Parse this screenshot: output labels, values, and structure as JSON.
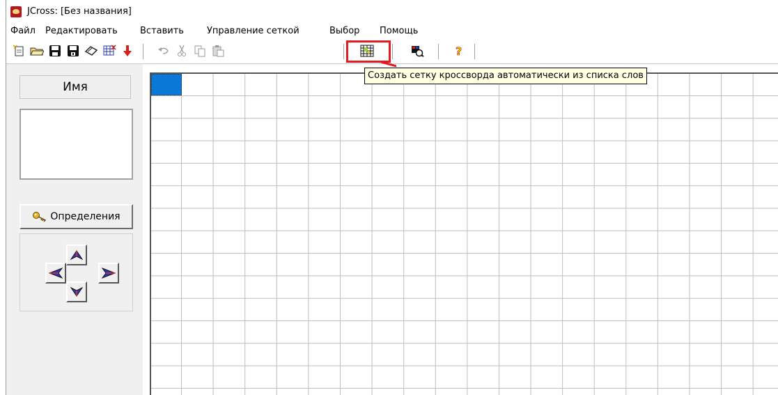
{
  "window": {
    "title": "JCross: [Без названия]"
  },
  "menu": {
    "items": [
      "Файл",
      "Редактировать",
      "Вставить",
      "Управление сеткой",
      "Выбор",
      "Помощь"
    ]
  },
  "toolbar": {
    "buttons": [
      {
        "icon": "new-file-icon"
      },
      {
        "icon": "open-folder-icon"
      },
      {
        "icon": "save-icon"
      },
      {
        "icon": "save-as-icon"
      },
      {
        "icon": "eraser-icon"
      },
      {
        "icon": "web-export-icon"
      },
      {
        "icon": "down-arrow-icon"
      },
      {
        "icon": "undo-icon"
      },
      {
        "icon": "cut-icon"
      },
      {
        "icon": "copy-icon"
      },
      {
        "icon": "paste-icon"
      },
      {
        "icon": "auto-grid-icon"
      },
      {
        "icon": "preview-icon"
      },
      {
        "icon": "help-icon"
      }
    ],
    "tooltip": "Создать сетку кроссворда автоматически из списка слов",
    "highlight_color": "#e31b23"
  },
  "left_panel": {
    "name_button": "Имя",
    "definitions_button": "Определения"
  },
  "grid": {
    "selected_color": "#0a78d7"
  }
}
